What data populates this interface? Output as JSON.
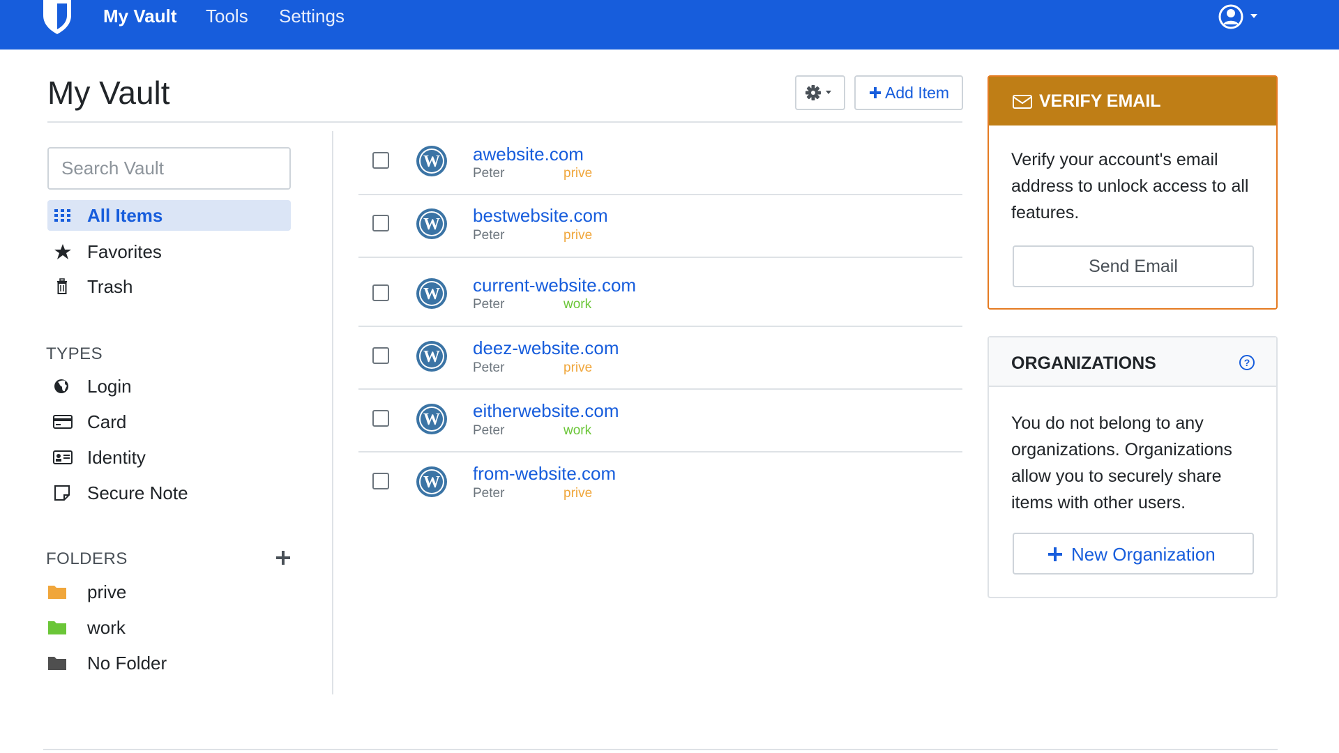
{
  "nav": {
    "items": [
      {
        "label": "My Vault",
        "active": true
      },
      {
        "label": "Tools",
        "active": false
      },
      {
        "label": "Settings",
        "active": false
      }
    ],
    "brand_icon": "shield-icon",
    "account_icon": "user-circle-icon"
  },
  "colors": {
    "navbar": "#175ddc",
    "accent": "#175ddc",
    "verify_header": "#bf7e16",
    "folder_prive": "#f0a63b",
    "folder_work": "#6bc638",
    "folder_none": "#4f4f4f"
  },
  "page": {
    "title": "My Vault",
    "settings_icon": "gear-icon",
    "add_item_label": "Add Item"
  },
  "sidebar": {
    "search_placeholder": "Search Vault",
    "filters": [
      {
        "label": "All Items",
        "icon": "grid-icon",
        "active": true
      },
      {
        "label": "Favorites",
        "icon": "star-icon",
        "active": false
      },
      {
        "label": "Trash",
        "icon": "trash-icon",
        "active": false
      }
    ],
    "types_title": "TYPES",
    "types": [
      {
        "label": "Login",
        "icon": "globe-icon"
      },
      {
        "label": "Card",
        "icon": "credit-card-icon"
      },
      {
        "label": "Identity",
        "icon": "id-card-icon"
      },
      {
        "label": "Secure Note",
        "icon": "note-icon"
      }
    ],
    "folders_title": "FOLDERS",
    "folders": [
      {
        "label": "prive",
        "icon": "folder-icon"
      },
      {
        "label": "work",
        "icon": "folder-icon"
      },
      {
        "label": "No Folder",
        "icon": "folder-icon"
      }
    ]
  },
  "items": [
    {
      "name": "awebsite.com",
      "owner": "Peter",
      "folder": "prive"
    },
    {
      "name": "bestwebsite.com",
      "owner": "Peter",
      "folder": "prive"
    },
    {
      "name": "current-website.com",
      "owner": "Peter",
      "folder": "work"
    },
    {
      "name": "deez-website.com",
      "owner": "Peter",
      "folder": "prive"
    },
    {
      "name": "eitherwebsite.com",
      "owner": "Peter",
      "folder": "work"
    },
    {
      "name": "from-website.com",
      "owner": "Peter",
      "folder": "prive"
    }
  ],
  "verify_email": {
    "title": "VERIFY EMAIL",
    "text": "Verify your account's email address to unlock access to all features.",
    "button": "Send Email",
    "icon": "envelope-icon"
  },
  "organizations": {
    "title": "ORGANIZATIONS",
    "help_icon": "question-circle-icon",
    "text": "You do not belong to any organizations. Organizations allow you to securely share items with other users.",
    "button": "New Organization"
  }
}
